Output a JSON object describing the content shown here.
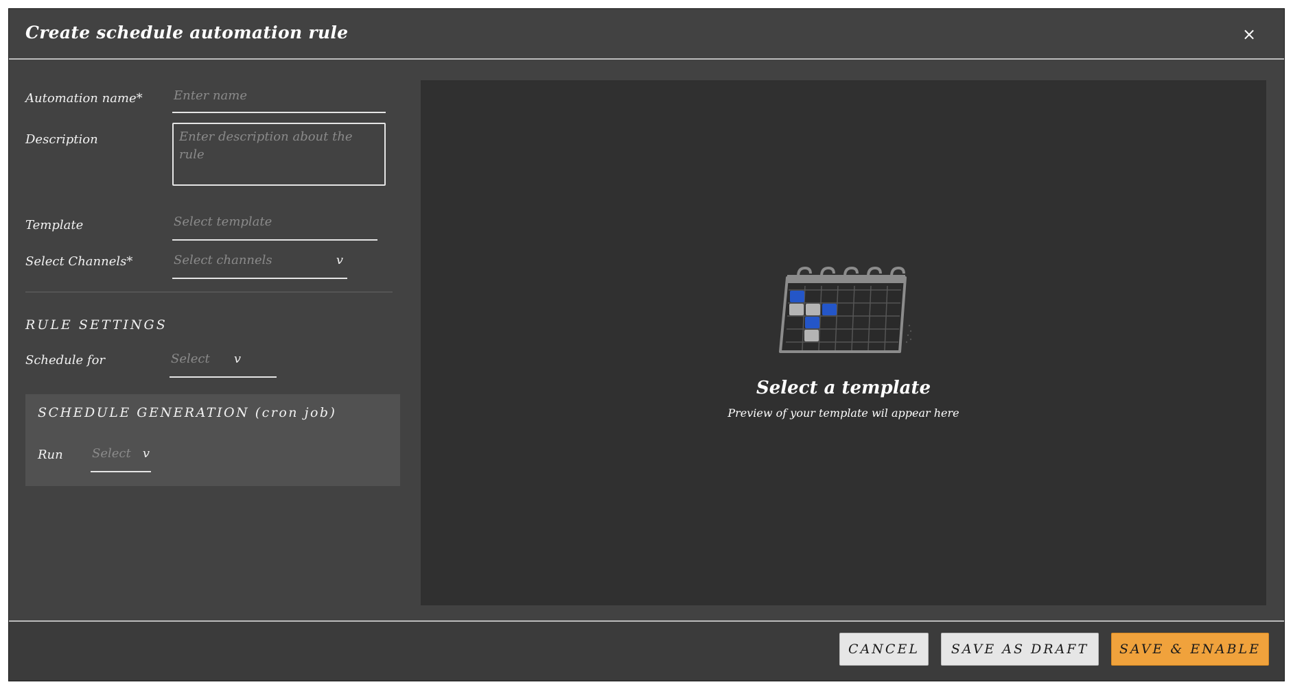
{
  "dialog": {
    "title": "Create schedule automation rule",
    "close_label": "×"
  },
  "form": {
    "name_label": "Automation name*",
    "name_placeholder": "Enter name",
    "description_label": "Description",
    "description_placeholder": "Enter description about the rule",
    "template_label": "Template",
    "template_placeholder": "Select template",
    "channels_label": "Select Channels*",
    "channels_placeholder": "Select channels",
    "chevron": "v"
  },
  "rule_settings": {
    "title": "RULE SETTINGS",
    "schedule_for_label": "Schedule for",
    "schedule_for_placeholder": "Select"
  },
  "cron": {
    "title": "SCHEDULE GENERATION (cron job)",
    "run_label": "Run",
    "run_placeholder": "Select"
  },
  "preview": {
    "icon": "calendar-icon",
    "title": "Select a template",
    "subtitle": "Preview of your template wil appear here"
  },
  "footer": {
    "cancel_label": "CANCEL",
    "draft_label": "SAVE AS DRAFT",
    "enable_label": "SAVE & ENABLE"
  },
  "colors": {
    "dialog_bg": "#424242",
    "preview_bg": "#303030",
    "accent": "#f0a23c",
    "calendar_blue": "#2456c8"
  }
}
